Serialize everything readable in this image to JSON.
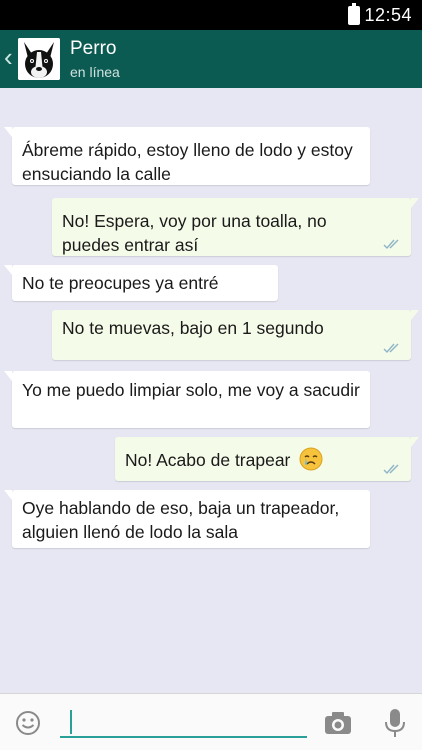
{
  "status_bar": {
    "time": "12:54"
  },
  "header": {
    "contact_name": "Perro",
    "status": "en línea"
  },
  "messages": [
    {
      "direction": "in",
      "text": "Ábreme rápido, estoy lleno de lodo y estoy ensuciando la calle"
    },
    {
      "direction": "out",
      "text": "No! Espera,  voy por una toalla, no puedes entrar así",
      "read": true
    },
    {
      "direction": "in",
      "text": "No te preocupes ya entré"
    },
    {
      "direction": "out",
      "text": "No te muevas, bajo en 1 segundo",
      "read": true
    },
    {
      "direction": "in",
      "text": "Yo me puedo limpiar solo, me voy a sacudir"
    },
    {
      "direction": "out",
      "text": "No! Acabo de trapear",
      "emoji": "crying-face-icon",
      "read": true
    },
    {
      "direction": "in",
      "text": "Oye hablando de eso, baja un trapeador, alguien llenó de lodo la sala"
    }
  ],
  "composer": {
    "value": ""
  },
  "colors": {
    "header": "#0c5b52",
    "chat_background": "#e6e7f2",
    "outgoing_bubble": "#f5fbe9",
    "incoming_bubble": "#ffffff",
    "read_ticks": "#8fb4c8",
    "accent": "#2aa198"
  }
}
